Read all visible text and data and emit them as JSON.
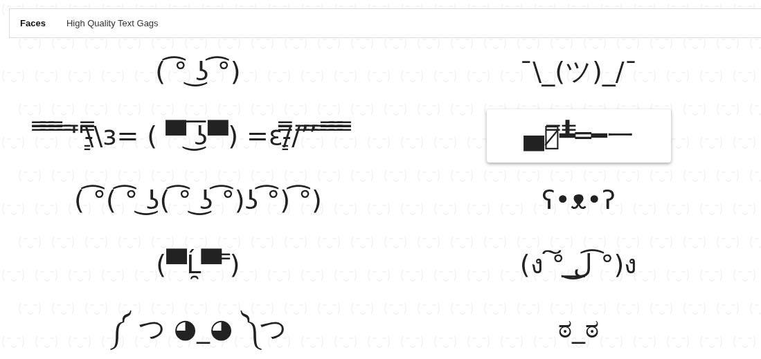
{
  "tabs": [
    {
      "label": "Faces",
      "selected": true
    },
    {
      "label": "High Quality Text Gags",
      "selected": false
    }
  ],
  "faces": [
    {
      "text": "( ͡° ͜ʖ ͡°)",
      "selected": false
    },
    {
      "text": "¯\\_(ツ)_/¯",
      "selected": false
    },
    {
      "text": "̿̿ ̿̿ ̿̿ ̿'̿'\\̵͇̿̿\\з= ( ▀ ͜͞ʖ▀) =ε/̵͇̿̿/’̿’̿ ̿ ̿̿ ̿̿ ̿̿",
      "selected": false
    },
    {
      "text": "▄︻̷̿┻̿═━一",
      "selected": true
    },
    {
      "text": "( ͡°( ͡° ͜ʖ( ͡° ͜ʖ ͡°)ʖ ͡°) ͡°)",
      "selected": false
    },
    {
      "text": "ʕ•ᴥ•ʔ",
      "selected": false
    },
    {
      "text": "(▀̿Ĺ̯▀̿ ̿)",
      "selected": false
    },
    {
      "text": "(ง ͠° ͟ل͜ ͡°)ง",
      "selected": false
    },
    {
      "text": "༼ つ ◕_◕ ༽つ",
      "selected": false
    },
    {
      "text": "ಠ_ಠ",
      "selected": false
    }
  ]
}
